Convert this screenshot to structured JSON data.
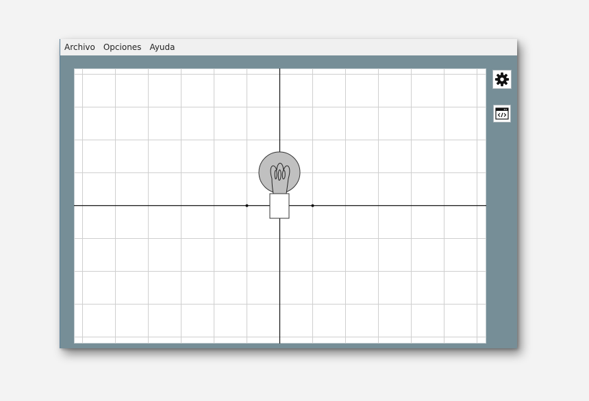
{
  "menu": {
    "items": [
      {
        "label": "Archivo"
      },
      {
        "label": "Opciones"
      },
      {
        "label": "Ayuda"
      }
    ]
  },
  "toolbar": {
    "settings_icon": "gear-icon",
    "code_view_icon": "code-window-icon"
  },
  "canvas": {
    "grid": true,
    "axes": true,
    "component": "light-bulb-icon",
    "colors": {
      "window_background": "#768e97",
      "grid_lines": "#c8c8c8",
      "axes": "#000000",
      "bulb_fill": "#c0c0c0"
    }
  }
}
